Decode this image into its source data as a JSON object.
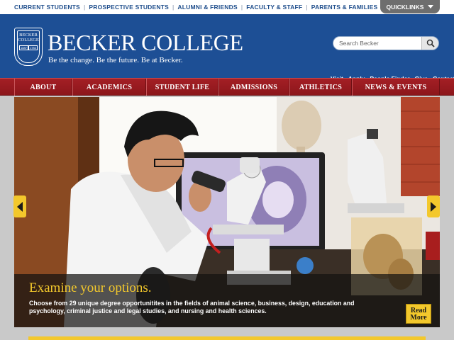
{
  "top_nav": {
    "items": [
      "CURRENT STUDENTS",
      "PROSPECTIVE STUDENTS",
      "ALUMNI & FRIENDS",
      "FACULTY & STAFF",
      "PARENTS & FAMILIES"
    ],
    "separator": "|"
  },
  "quicklinks": {
    "label": "QUICKLINKS"
  },
  "brand": {
    "name": "BECKER COLLEGE",
    "seal_text": [
      "BECKER",
      "COLLEGE"
    ],
    "seal_years": [
      "1887",
      "1784"
    ],
    "tagline": "Be the change. Be the future. Be at Becker."
  },
  "search": {
    "placeholder": "Search Becker",
    "icon": "search-icon"
  },
  "utility_links": [
    "Visit",
    "Apply",
    "People Finder",
    "Give",
    "Contact"
  ],
  "main_nav": [
    "ABOUT",
    "ACADEMICS",
    "STUDENT LIFE",
    "ADMISSIONS",
    "ATHLETICS",
    "NEWS & EVENTS"
  ],
  "hero": {
    "headline": "Examine your options.",
    "body": "Choose from 29 unique degree opportunitites in the fields of animal science, business, design, education and psychology, criminal justice and legal studies, and nursing and health sciences.",
    "read_more": [
      "Read",
      "More"
    ],
    "prev_icon": "arrow-left-icon",
    "next_icon": "arrow-right-icon"
  },
  "colors": {
    "header_blue": "#1d4f95",
    "nav_red": "#9a1a20",
    "accent_yellow": "#f3c82c",
    "top_link_blue": "#1f4e8c"
  }
}
